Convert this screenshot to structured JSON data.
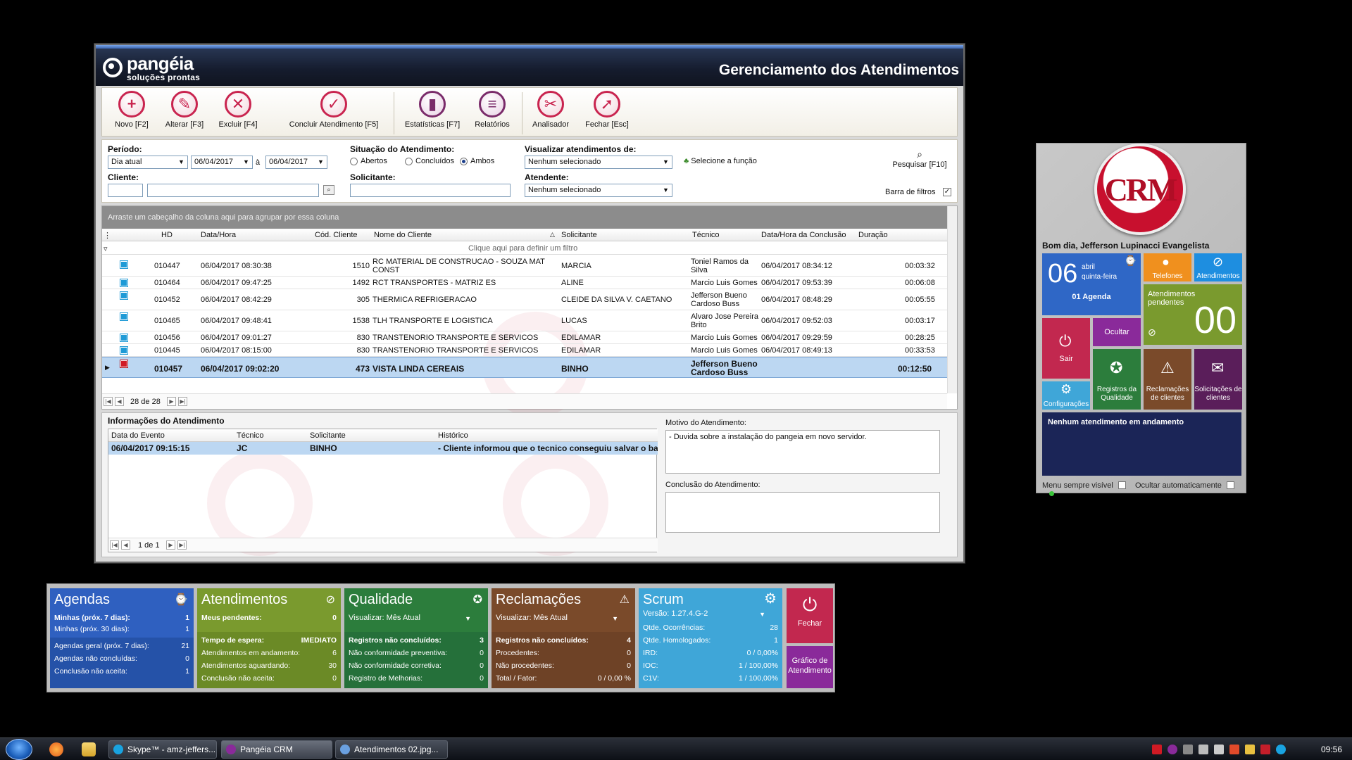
{
  "window": {
    "title": "Gerenciamento dos Atendimentos",
    "logo_name": "pangéia",
    "logo_sub": "soluções prontas"
  },
  "toolbar": {
    "buttons": [
      {
        "label": "Novo [F2]",
        "icon": "plus-icon"
      },
      {
        "label": "Alterar [F3]",
        "icon": "pencil-icon"
      },
      {
        "label": "Excluir [F4]",
        "icon": "x-icon"
      },
      {
        "label": "Concluir Atendimento [F5]",
        "icon": "check-icon"
      },
      {
        "label": "Estatísticas [F7]",
        "icon": "bar-chart-icon"
      },
      {
        "label": "Relatórios",
        "icon": "document-icon"
      },
      {
        "label": "Analisador",
        "icon": "tools-icon"
      },
      {
        "label": "Fechar [Esc]",
        "icon": "running-man-icon"
      }
    ]
  },
  "filters": {
    "periodo_label": "Período:",
    "periodo_value": "Dia atual",
    "date_from": "06/04/2017",
    "date_sep": "à",
    "date_to": "06/04/2017",
    "cliente_label": "Cliente:",
    "situacao_label": "Situação do Atendimento:",
    "radio_abertos": "Abertos",
    "radio_concluidos": "Concluídos",
    "radio_ambos": "Ambos",
    "solicitante_label": "Solicitante:",
    "visualizar_label": "Visualizar atendimentos de:",
    "visualizar_value": "Nenhum selecionado",
    "selecione_funcao": "Selecione a função",
    "atendente_label": "Atendente:",
    "atendente_value": "Nenhum selecionado",
    "pesquisar": "Pesquisar [F10]",
    "barra_filtros": "Barra de filtros"
  },
  "grid": {
    "group_hint": "Arraste um cabeçalho da coluna aqui para agrupar por essa coluna",
    "filter_hint": "Clique aqui para definir um filtro",
    "columns": [
      "HD",
      "Data/Hora",
      "Cód. Cliente",
      "Nome do Cliente",
      "Solicitante",
      "Técnico",
      "Data/Hora da Conclusão",
      "Duração"
    ],
    "rows": [
      {
        "hd": "010447",
        "data": "06/04/2017 08:30:38",
        "cod": "1510",
        "nome": "RC MATERIAL DE CONSTRUCAO - SOUZA MAT CONST",
        "solic": "MARCIA",
        "tec": "Toniel Ramos da Silva",
        "concl": "06/04/2017 08:34:12",
        "dur": "00:03:32"
      },
      {
        "hd": "010464",
        "data": "06/04/2017 09:47:25",
        "cod": "1492",
        "nome": "RCT TRANSPORTES - MATRIZ ES",
        "solic": "ALINE",
        "tec": "Marcio Luis Gomes",
        "concl": "06/04/2017 09:53:39",
        "dur": "00:06:08"
      },
      {
        "hd": "010452",
        "data": "06/04/2017 08:42:29",
        "cod": "305",
        "nome": "THERMICA REFRIGERACAO",
        "solic": "CLEIDE DA SILVA V. CAETANO",
        "tec": "Jefferson Bueno Cardoso Buss",
        "concl": "06/04/2017 08:48:29",
        "dur": "00:05:55"
      },
      {
        "hd": "010465",
        "data": "06/04/2017 09:48:41",
        "cod": "1538",
        "nome": "TLH TRANSPORTE E LOGISTICA",
        "solic": "LUCAS",
        "tec": "Alvaro Jose Pereira Brito",
        "concl": "06/04/2017 09:52:03",
        "dur": "00:03:17"
      },
      {
        "hd": "010456",
        "data": "06/04/2017 09:01:27",
        "cod": "830",
        "nome": "TRANSTENORIO TRANSPORTE E SERVICOS",
        "solic": "EDILAMAR",
        "tec": "Marcio Luis Gomes",
        "concl": "06/04/2017 09:29:59",
        "dur": "00:28:25"
      },
      {
        "hd": "010445",
        "data": "06/04/2017 08:15:00",
        "cod": "830",
        "nome": "TRANSTENORIO TRANSPORTE E SERVICOS",
        "solic": "EDILAMAR",
        "tec": "Marcio Luis Gomes",
        "concl": "06/04/2017 08:49:13",
        "dur": "00:33:53"
      },
      {
        "hd": "010457",
        "data": "06/04/2017 09:02:20",
        "cod": "473",
        "nome": "VISTA LINDA CEREAIS",
        "solic": "BINHO",
        "tec": "Jefferson Bueno Cardoso Buss",
        "concl": "",
        "dur": "00:12:50"
      }
    ],
    "pager": "28 de 28"
  },
  "info": {
    "title": "Informações do Atendimento",
    "columns": [
      "Data do Evento",
      "Técnico",
      "Solicitante",
      "Histórico"
    ],
    "row": {
      "data": "06/04/2017 09:15:15",
      "tec": "JC",
      "solic": "BINHO",
      "hist": "- Cliente informou que o tecnico conseguiu salvar o ba"
    },
    "pager": "1 de 1",
    "motivo_label": "Motivo do Atendimento:",
    "motivo_text": "- Duvida sobre a instalação do pangeia em novo servidor.",
    "conclusao_label": "Conclusão do Atendimento:"
  },
  "crm": {
    "logo_text": "CRM",
    "greeting": "Bom dia, Jefferson Lupinacci Evangelista",
    "day": "06",
    "month": "abril",
    "weekday": "quinta-feira",
    "agenda": "01 Agenda",
    "telefones": "Telefones",
    "atendimentos": "Atendimentos",
    "pendentes_label": "Atendimentos pendentes",
    "pendentes_value": "00",
    "sair": "Sair",
    "ocultar": "Ocultar",
    "configuracoes": "Configurações",
    "registros": "Registros da Qualidade",
    "reclamacoes": "Reclamações de clientes",
    "solicitacoes": "Solicitações de clientes",
    "status": "Nenhum atendimento em andamento",
    "menu_visivel": "Menu sempre visível",
    "ocultar_auto": "Ocultar automaticamente"
  },
  "dashboard": {
    "agendas": {
      "title": "Agendas",
      "lines": [
        {
          "l": "Minhas (próx. 7 dias):",
          "v": "1"
        },
        {
          "l": "Minhas (próx. 30 dias):",
          "v": "1"
        },
        {
          "l": "Agendas geral (próx. 7 dias):",
          "v": "21"
        },
        {
          "l": "Agendas não concluídas:",
          "v": "0"
        },
        {
          "l": "Conclusão não aceita:",
          "v": "1"
        }
      ]
    },
    "atendimentos": {
      "title": "Atendimentos",
      "lines": [
        {
          "l": "Meus pendentes:",
          "v": "0"
        },
        {
          "l": "Tempo de espera:",
          "v": "IMEDIATO"
        },
        {
          "l": "Atendimentos em andamento:",
          "v": "6"
        },
        {
          "l": "Atendimentos aguardando:",
          "v": "30"
        },
        {
          "l": "Conclusão não aceita:",
          "v": "0"
        }
      ]
    },
    "qualidade": {
      "title": "Qualidade",
      "select": "Visualizar: Mês Atual",
      "lines": [
        {
          "l": "Registros não concluídos:",
          "v": "3"
        },
        {
          "l": "Não conformidade preventiva:",
          "v": "0"
        },
        {
          "l": "Não conformidade corretiva:",
          "v": "0"
        },
        {
          "l": "Registro de Melhorias:",
          "v": "0"
        }
      ]
    },
    "reclamacoes": {
      "title": "Reclamações",
      "select": "Visualizar: Mês Atual",
      "lines": [
        {
          "l": "Registros não concluídos:",
          "v": "4"
        },
        {
          "l": "Procedentes:",
          "v": "0"
        },
        {
          "l": "Não procedentes:",
          "v": "0"
        },
        {
          "l": "Total / Fator:",
          "v": "0 / 0,00 %"
        }
      ]
    },
    "scrum": {
      "title": "Scrum",
      "select": "Versão: 1.27.4.G-2",
      "lines": [
        {
          "l": "Qtde. Ocorrências:",
          "v": "28"
        },
        {
          "l": "Qtde. Homologados:",
          "v": "1"
        },
        {
          "l": "IRD:",
          "v": "0 / 0,00%"
        },
        {
          "l": "IOC:",
          "v": "1 / 100,00%"
        },
        {
          "l": "C1V:",
          "v": "1 / 100,00%"
        }
      ]
    },
    "fechar": "Fechar",
    "grafico": "Gráfico de Atendimento"
  },
  "taskbar": {
    "tasks": [
      "Skype™ - amz-jeffers...",
      "Pangéia CRM",
      "Atendimentos 02.jpg..."
    ],
    "clock": "09:56"
  }
}
